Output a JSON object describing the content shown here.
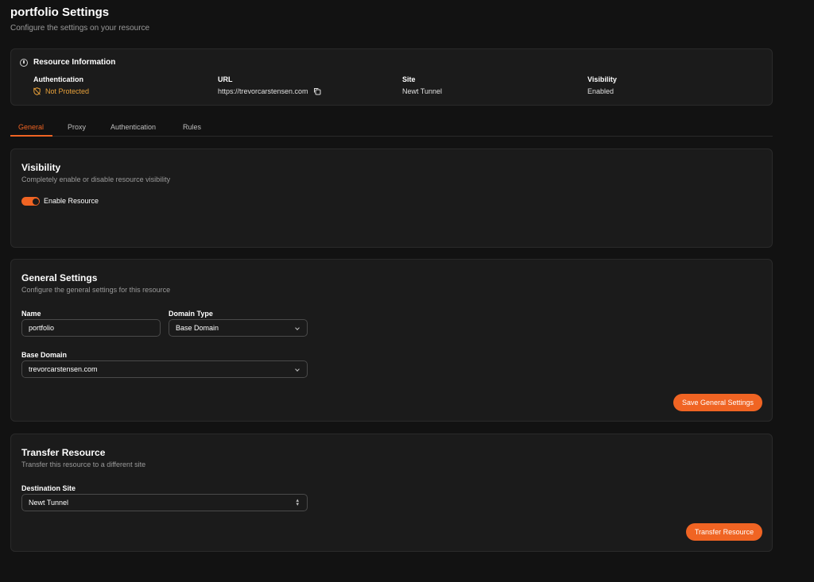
{
  "header": {
    "title": "portfolio Settings",
    "subtitle": "Configure the settings on your resource"
  },
  "resource_info": {
    "title": "Resource Information",
    "icon": "info-icon",
    "authentication": {
      "label": "Authentication",
      "value": "Not Protected",
      "icon": "shield-off-icon",
      "color": "#e8a13a"
    },
    "url": {
      "label": "URL",
      "value": "https://trevorcarstensen.com",
      "icon": "copy-icon"
    },
    "site": {
      "label": "Site",
      "value": "Newt Tunnel"
    },
    "visibility": {
      "label": "Visibility",
      "value": "Enabled"
    }
  },
  "tabs": [
    {
      "label": "General",
      "active": true
    },
    {
      "label": "Proxy",
      "active": false
    },
    {
      "label": "Authentication",
      "active": false
    },
    {
      "label": "Rules",
      "active": false
    }
  ],
  "visibility": {
    "title": "Visibility",
    "subtitle": "Completely enable or disable resource visibility",
    "toggle_label": "Enable Resource",
    "enabled": true
  },
  "general": {
    "title": "General Settings",
    "subtitle": "Configure the general settings for this resource",
    "name_label": "Name",
    "name_value": "portfolio",
    "domain_type_label": "Domain Type",
    "domain_type_value": "Base Domain",
    "base_domain_label": "Base Domain",
    "base_domain_value": "trevorcarstensen.com",
    "save_label": "Save General Settings"
  },
  "transfer": {
    "title": "Transfer Resource",
    "subtitle": "Transfer this resource to a different site",
    "destination_label": "Destination Site",
    "destination_value": "Newt Tunnel",
    "button_label": "Transfer Resource"
  },
  "colors": {
    "accent": "#f06423",
    "background": "#121212",
    "card": "#1b1b1b",
    "warning": "#e8a13a"
  }
}
